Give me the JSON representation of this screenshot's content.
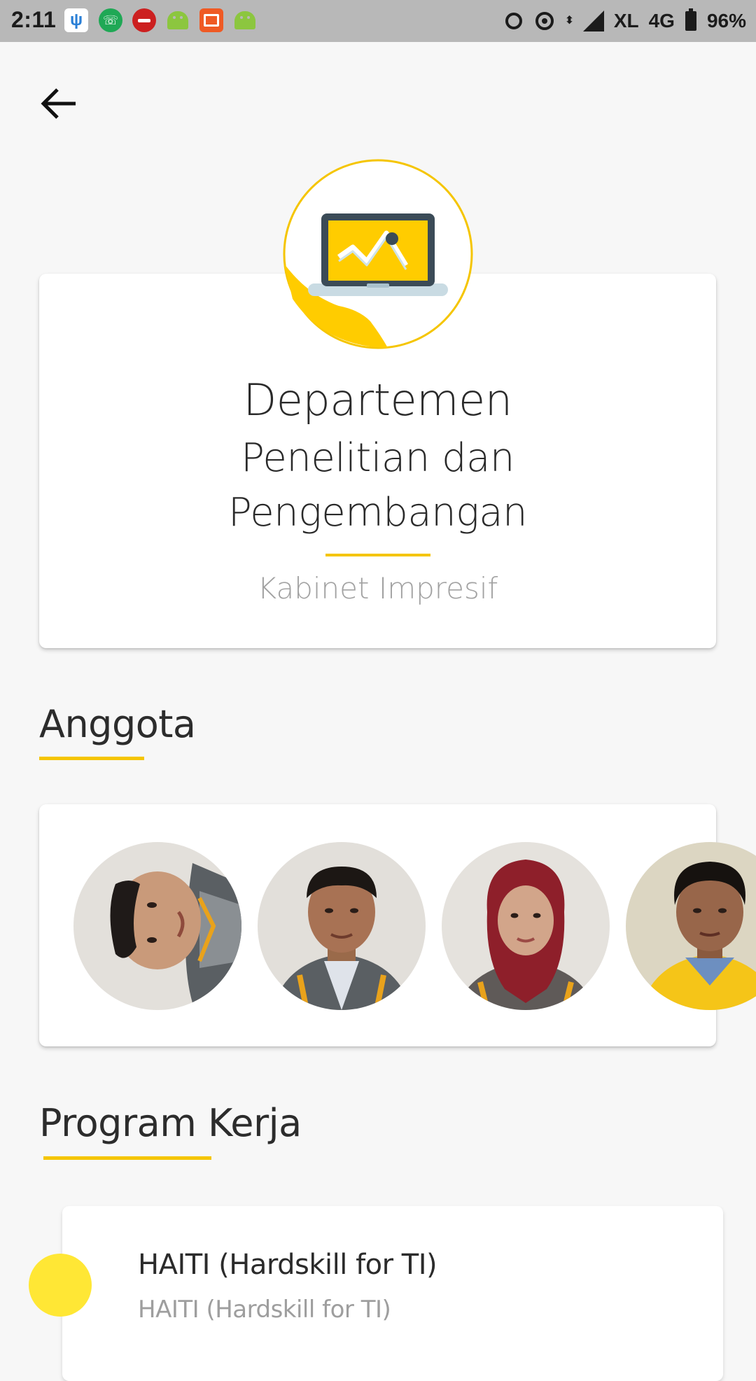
{
  "status_bar": {
    "time": "2:11",
    "carrier": "XL",
    "network": "4G",
    "battery": "96%",
    "notification_icons": [
      "usb-icon",
      "whatsapp-icon",
      "red-circle-app-icon",
      "android-icon",
      "video-camera-icon",
      "android-icon"
    ],
    "system_icons": [
      "alarm-icon",
      "hotspot-icon",
      "data-arrows-icon",
      "signal-icon",
      "battery-icon"
    ]
  },
  "nav": {
    "back_icon": "arrow-left-icon"
  },
  "header": {
    "emblem_icon": "laptop-chart-icon",
    "title_line1": "Departemen",
    "title_line2": "Penelitian dan",
    "title_line3": "Pengembangan",
    "subtitle": "Kabinet Impresif"
  },
  "members": {
    "heading": "Anggota",
    "avatar_count_visible": 4
  },
  "programs": {
    "heading": "Program Kerja",
    "items": [
      {
        "name": "HAITI (Hardskill for TI)",
        "description": "HAITI (Hardskill for TI)"
      }
    ]
  },
  "colors": {
    "accent": "#f5c500",
    "program_dot": "#ffe735",
    "background": "#f7f7f7",
    "status_bar": "#b8b8b8"
  }
}
